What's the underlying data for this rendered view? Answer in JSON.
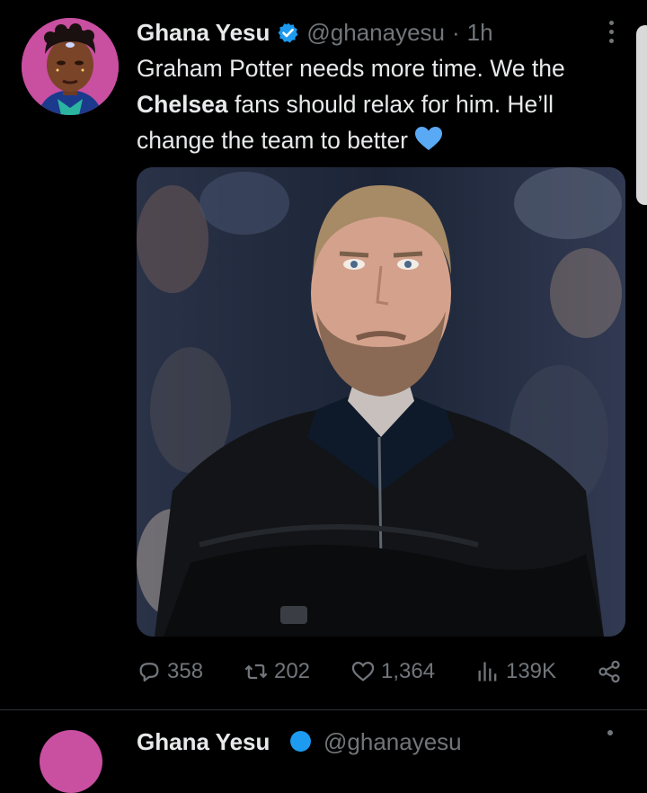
{
  "tweet": {
    "author_name": "Ghana Yesu",
    "handle": "@ghanayesu",
    "separator": "·",
    "time": "1h",
    "text_part1": "Graham Potter needs more time. We the ",
    "text_bold": "Chelsea",
    "text_part2": " fans should relax for him. He’ll change the team to better",
    "emoji": "blue-heart-icon",
    "stats": {
      "replies": "358",
      "retweets": "202",
      "likes": "1,364",
      "views": "139K"
    }
  },
  "next_tweet": {
    "author_name": "Ghana Yesu",
    "handle": "@ghanayesu"
  },
  "colors": {
    "background": "#000000",
    "text": "#e7e9ea",
    "secondary": "#71767b",
    "verified": "#1d9bf0",
    "heart": "#5aa9f5",
    "avatar_bg": "#c94fa0"
  }
}
